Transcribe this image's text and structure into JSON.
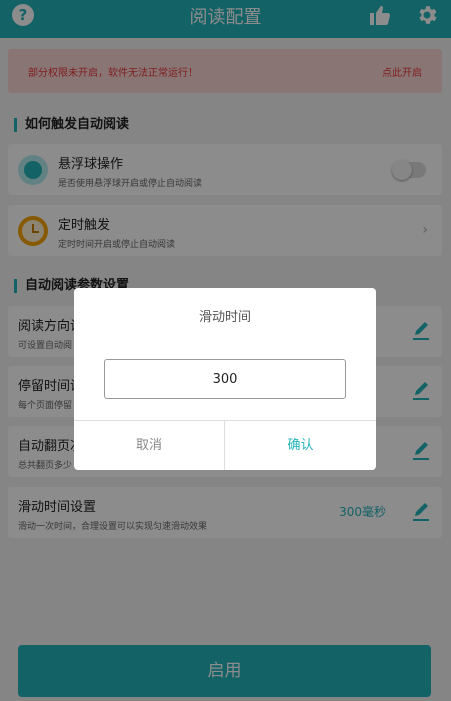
{
  "header": {
    "title": "阅读配置",
    "help_icon": "?"
  },
  "warning": {
    "message": "部分权限未开启，软件无法正常运行！",
    "action": "点此开启"
  },
  "section1": {
    "title": "如何触发自动阅读",
    "float_ball": {
      "title": "悬浮球操作",
      "desc": "是否使用悬浮球开启或停止自动阅读"
    },
    "timer": {
      "title": "定时触发",
      "desc": "定时时间开启或停止自动阅读",
      "chevron": "›"
    }
  },
  "section2": {
    "title": "自动阅读参数设置",
    "items": [
      {
        "title": "阅读方向设",
        "desc": "可设置自动阅"
      },
      {
        "title": "停留时间设",
        "desc": "每个页面停留"
      },
      {
        "title": "自动翻页次",
        "desc": "总共翻页多少"
      },
      {
        "title": "滑动时间设置",
        "desc": "滑动一次时间，合理设置可以实现匀速滑动效果",
        "value": "300毫秒"
      }
    ]
  },
  "enable_button": "启用",
  "dialog": {
    "title": "滑动时间",
    "input_value": "300",
    "cancel": "取消",
    "confirm": "确认"
  },
  "colors": {
    "accent": "#23b3bb",
    "warning_bg": "#fbd6d6",
    "warning_text": "#e53935"
  }
}
